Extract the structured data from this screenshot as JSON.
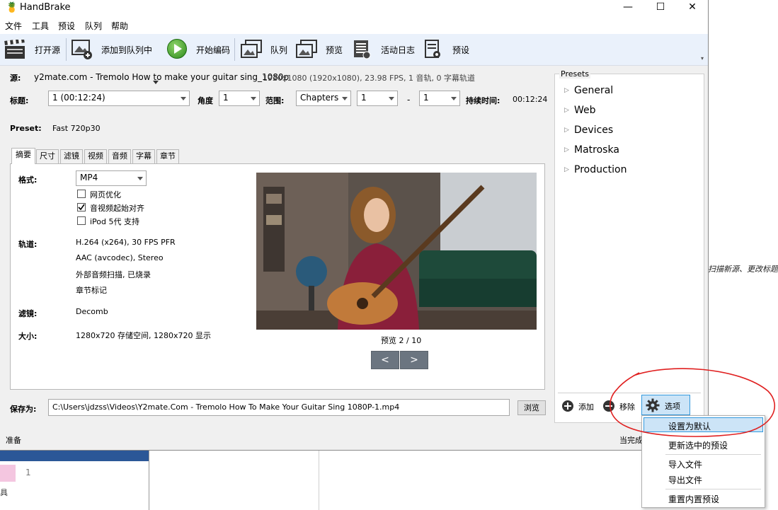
{
  "background": {
    "right_text": "扫描新源、更改标题.",
    "left_number": "1",
    "left_char": "具"
  },
  "window": {
    "title": "HandBrake",
    "controls": {
      "minimize": "—",
      "maximize": "☐",
      "close": "✕"
    }
  },
  "menu": [
    "文件",
    "工具",
    "预设",
    "队列",
    "帮助"
  ],
  "toolbar": {
    "open_source": "打开源",
    "add_to_queue": "添加到队列中",
    "start_encode": "开始编码",
    "queue": "队列",
    "preview": "预览",
    "activity_log": "活动日志",
    "presets": "预设"
  },
  "source": {
    "label": "源:",
    "name": "y2mate.com - Tremolo How to make your guitar sing_1080p",
    "info": "1920x1080 (1920x1080), 23.98 FPS, 1 音轨, 0 字幕轨道"
  },
  "title_row": {
    "title_label": "标题:",
    "title_value": "1  (00:12:24)",
    "angle_label": "角度",
    "angle_value": "1",
    "range_label": "范围:",
    "range_type": "Chapters",
    "range_start": "1",
    "dash": "-",
    "range_end": "1",
    "duration_label": "持续时间:",
    "duration_value": "00:12:24"
  },
  "preset_row": {
    "label": "Preset:",
    "value": "Fast 720p30"
  },
  "tabs": [
    "摘要",
    "尺寸",
    "滤镜",
    "视频",
    "音频",
    "字幕",
    "章节"
  ],
  "summary": {
    "format_label": "格式:",
    "format_value": "MP4",
    "web_optimize": {
      "label": "网页优化",
      "checked": false
    },
    "align_av": {
      "label": "音视频起始对齐",
      "checked": true
    },
    "ipod": {
      "label": "iPod 5代 支持",
      "checked": false
    },
    "tracks_label": "轨道:",
    "tracks": [
      "H.264 (x264), 30 FPS PFR",
      "AAC (avcodec), Stereo",
      "外部音频扫描, 已烧录",
      "章节标记"
    ],
    "filters_label": "滤镜:",
    "filters_value": "Decomb",
    "size_label": "大小:",
    "size_value": "1280x720 存储空间, 1280x720 显示"
  },
  "preview": {
    "counter": "预览 2 / 10",
    "prev": "<",
    "next": ">"
  },
  "save": {
    "label": "保存为:",
    "path": "C:\\Users\\jdzss\\Videos\\Y2mate.Com - Tremolo How To Make Your Guitar Sing 1080P-1.mp4",
    "browse": "浏览"
  },
  "presets_panel": {
    "title": "Presets",
    "groups": [
      "General",
      "Web",
      "Devices",
      "Matroska",
      "Production"
    ],
    "add": "添加",
    "remove": "移除",
    "options": "选项"
  },
  "status": {
    "left": "准备",
    "right": "当完成"
  },
  "context_menu": {
    "items": [
      "设置为默认",
      "更新选中的预设",
      "导入文件",
      "导出文件",
      "重置内置预设"
    ],
    "highlighted": "设置为默认"
  },
  "colors": {
    "toolbar_bg": "#eaf1fb",
    "annotation_red": "#e02020",
    "highlight": "#cce4f7"
  }
}
